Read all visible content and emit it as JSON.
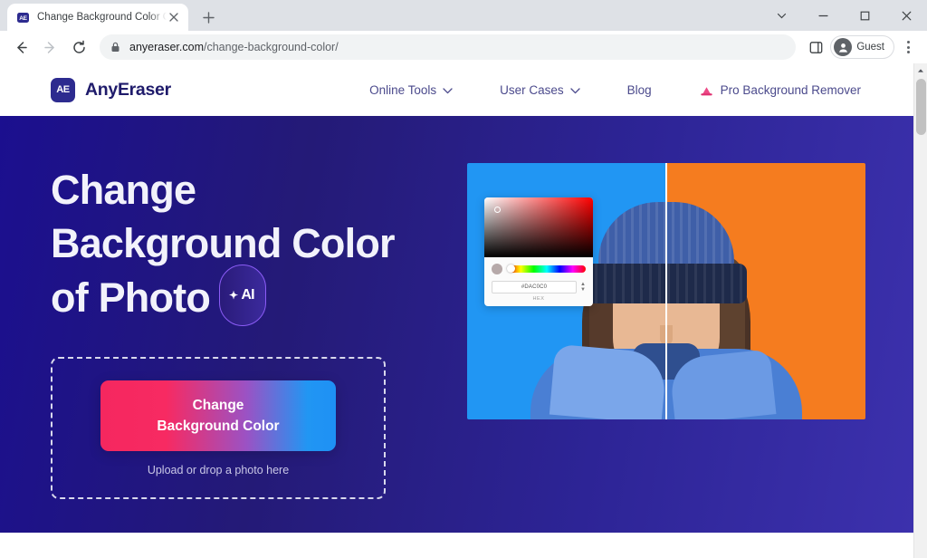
{
  "browser": {
    "tab": {
      "favicon_label": "AE",
      "title": "Change Background Color Onlin",
      "close_icon": "close-icon"
    },
    "new_tab_label": "+",
    "window_controls": {
      "minimize_group": "chevron-down-icon",
      "minimize": "minimize-icon",
      "maximize": "maximize-icon",
      "close": "close-icon"
    },
    "nav": {
      "back": "back-arrow-icon",
      "forward": "forward-arrow-icon",
      "reload": "reload-icon"
    },
    "omnibox": {
      "lock_icon": "lock-icon",
      "url_domain": "anyeraser.com",
      "url_path": "/change-background-color/",
      "full_url": "anyeraser.com/change-background-color/"
    },
    "toolbar_right": {
      "side_panel_icon": "side-panel-icon",
      "profile_label": "Guest",
      "profile_icon": "person-icon",
      "menu_icon": "kebab-menu-icon"
    }
  },
  "site": {
    "brand": {
      "mark": "AE",
      "name": "AnyEraser"
    },
    "nav_items": [
      {
        "label": "Online Tools",
        "has_chevron": true,
        "icon": null
      },
      {
        "label": "User Cases",
        "has_chevron": true,
        "icon": null
      },
      {
        "label": "Blog",
        "has_chevron": false,
        "icon": null
      },
      {
        "label": "Pro Background Remover",
        "has_chevron": false,
        "icon": "eraser-icon"
      }
    ]
  },
  "hero": {
    "heading_line1": "Change",
    "heading_line2": "Background Color",
    "heading_line3": "of Photo",
    "ai_badge": {
      "spark": "✦",
      "label": "AI"
    },
    "cta": {
      "line1": "Change",
      "line2": "Background Color"
    },
    "dropzone_hint": "Upload or drop a photo here",
    "colors": {
      "bg_gradient_start": "#1B0F8F",
      "bg_gradient_end": "#3C31AD",
      "cta_gradient_start": "#F5275F",
      "cta_gradient_end": "#1E90F5",
      "ai_badge_border": "#8B5CF6"
    }
  },
  "preview": {
    "before_bg_color": "#2196F3",
    "after_bg_color": "#F57C1F",
    "subject": "woman-with-beanie-and-sunglasses",
    "picker": {
      "hex_value": "#DAC0C0",
      "hex_label": "HEX",
      "stepper_up": "▲",
      "stepper_down": "▼"
    }
  },
  "scrollbar": {
    "up_arrow": "▲"
  }
}
